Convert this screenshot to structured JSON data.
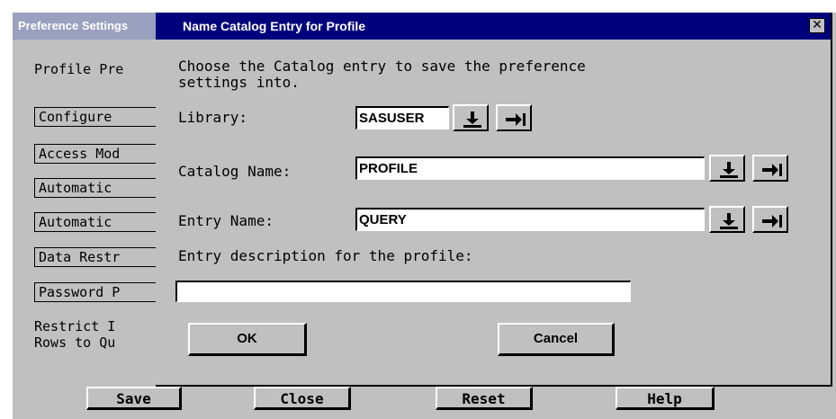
{
  "background_window": {
    "title": "Preference Settings",
    "heading": "Profile Pre",
    "items": [
      "Configure",
      "Access Mod",
      "Automatic",
      "Automatic",
      "Data Restr",
      "Password P"
    ],
    "restrict_line1": "Restrict I",
    "restrict_line2": "Rows to Qu",
    "buttons": {
      "save": "Save",
      "close": "Close",
      "reset": "Reset",
      "help": "Help"
    }
  },
  "dialog": {
    "title": "Name Catalog Entry for Profile",
    "close_glyph": "✕",
    "instruction_line1": "Choose the Catalog entry to save the preference",
    "instruction_line2": "settings into.",
    "library": {
      "label": "Library:",
      "value": "SASUSER"
    },
    "catalog": {
      "label": "Catalog Name:",
      "value": "PROFILE"
    },
    "entry": {
      "label": "Entry Name:",
      "value": "QUERY"
    },
    "description": {
      "label": "Entry description for the profile:",
      "value": ""
    },
    "buttons": {
      "ok": "OK",
      "cancel": "Cancel"
    },
    "icons": {
      "dropdown": "arrow-down-to-bar-icon",
      "browse": "arrow-right-to-bar-icon"
    }
  }
}
